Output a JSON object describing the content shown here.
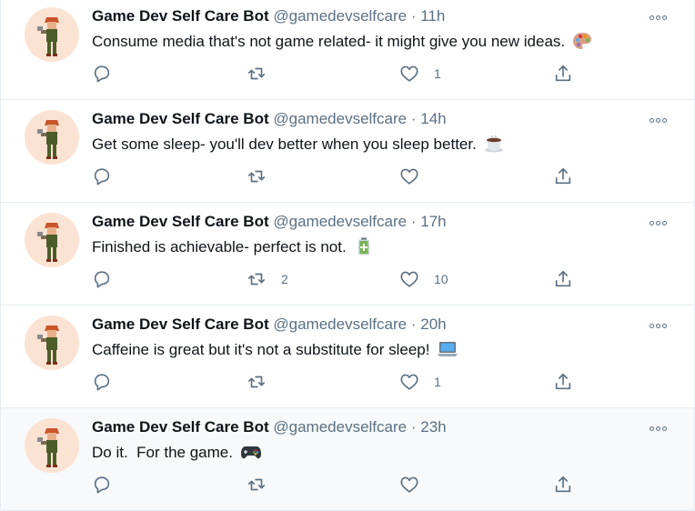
{
  "account": {
    "name": "Game Dev Self Care Bot",
    "handle": "@gamedevselfcare",
    "separator": "·"
  },
  "colors": {
    "text_primary": "#0f1419",
    "text_secondary": "#5b7083",
    "avatar_bg": "#fbe3d4",
    "divider": "#e6ecf0"
  },
  "tweets": [
    {
      "time": "11h",
      "text": "Consume media that's not game related- it might give you new ideas.",
      "emoji": "artist-palette-icon",
      "replies": "",
      "retweets": "",
      "likes": "1"
    },
    {
      "time": "14h",
      "text": "Get some sleep- you'll dev better when you sleep better.",
      "emoji": "hot-beverage-icon",
      "replies": "",
      "retweets": "",
      "likes": ""
    },
    {
      "time": "17h",
      "text": "Finished is achievable- perfect is not.",
      "emoji": "battery-icon",
      "replies": "",
      "retweets": "2",
      "likes": "10"
    },
    {
      "time": "20h",
      "text": "Caffeine is great but it's not a substitute for sleep!",
      "emoji": "laptop-icon",
      "replies": "",
      "retweets": "",
      "likes": "1"
    },
    {
      "time": "23h",
      "text": "Do it.  For the game.",
      "emoji": "video-game-controller-icon",
      "replies": "",
      "retweets": "",
      "likes": ""
    }
  ]
}
